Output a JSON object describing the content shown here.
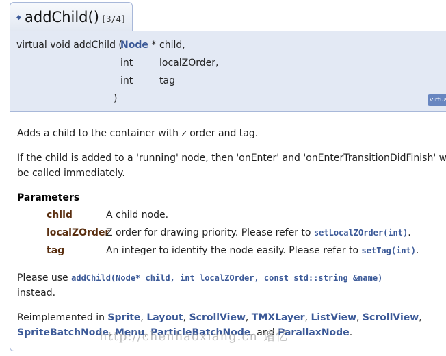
{
  "header": {
    "bullet": "◆",
    "title": "addChild()",
    "counter": "[3/4]"
  },
  "prototype": {
    "prefix": "virtual void addChild (",
    "params": [
      {
        "type": "Node",
        "suffix": " *",
        "name": "child,"
      },
      {
        "type": "int",
        "suffix": "",
        "name": "localZOrder,"
      },
      {
        "type": "int",
        "suffix": "",
        "name": "tag"
      }
    ],
    "close": ")",
    "badge": "virtual"
  },
  "doc": {
    "brief": "Adds a child to the container with z order and tag.",
    "detail_line1": "If the child is added to a 'running' node, then 'onEnter' and 'onEnterTransitionDidFinish' will",
    "detail_line2": "be called immediately.",
    "params_heading": "Parameters",
    "params": [
      {
        "name": "child",
        "desc": "A child node.",
        "link": "",
        "end": ""
      },
      {
        "name": "localZOrder",
        "desc": "Z order for drawing priority. Please refer to ",
        "link": "setLocalZOrder(int)",
        "end": "."
      },
      {
        "name": "tag",
        "desc": "An integer to identify the node easily. Please refer to ",
        "link": "setTag(int)",
        "end": "."
      }
    ],
    "note_prefix": "Please use ",
    "note_code": "addChild(Node* child, int localZOrder, const std::string &name)",
    "note_suffix": "instead.",
    "reimpl_prefix": "Reimplemented in ",
    "reimpl_line1": [
      {
        "name": "Sprite",
        "sep": ", "
      },
      {
        "name": "Layout",
        "sep": ", "
      },
      {
        "name": "ScrollView",
        "sep": ", "
      },
      {
        "name": "TMXLayer",
        "sep": ", "
      },
      {
        "name": "ListView",
        "sep": ", "
      },
      {
        "name": "ScrollView",
        "sep": ","
      }
    ],
    "reimpl_line2": [
      {
        "name": "SpriteBatchNode",
        "sep": ", "
      },
      {
        "name": "Menu",
        "sep": ", "
      },
      {
        "name": "ParticleBatchNode",
        "sep": ", and "
      },
      {
        "name": "ParallaxNode",
        "sep": "."
      }
    ]
  },
  "watermark": "http://chenhaoxiang.cn 诸亿"
}
